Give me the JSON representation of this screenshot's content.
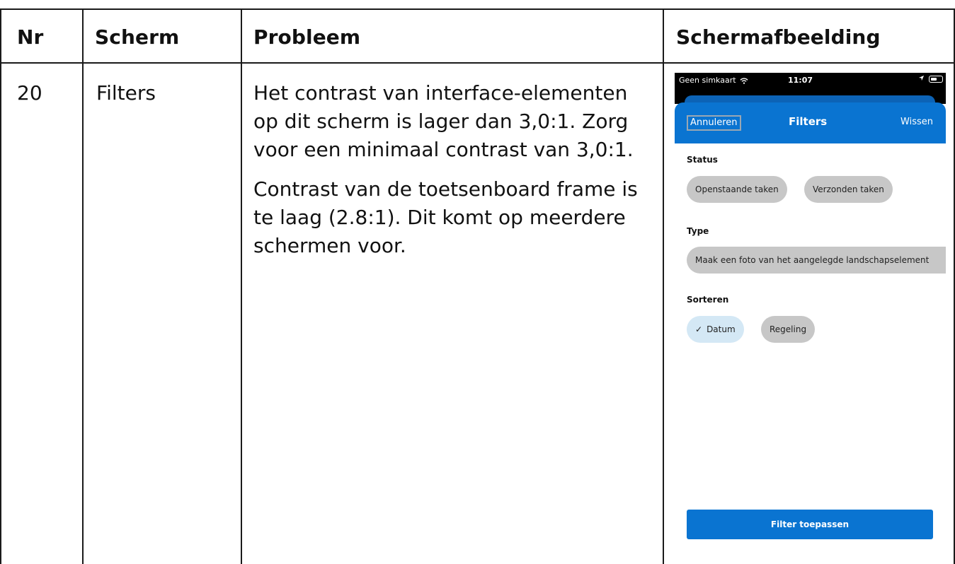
{
  "headers": {
    "nr": "Nr",
    "scherm": "Scherm",
    "probleem": "Probleem",
    "schermafbeelding": "Schermafbeelding"
  },
  "row": {
    "nr": "20",
    "scherm": "Filters",
    "probleem_paragraphs": [
      "Het contrast van interface-elementen op dit scherm is lager dan 3,0:1. Zorg voor een minimaal contrast van 3,0:1.",
      "Contrast van de toetsenboard frame is te laag (2.8:1). Dit komt op meerdere schermen voor."
    ]
  },
  "screenshot": {
    "status_bar": {
      "carrier": "Geen simkaart",
      "time": "11:07"
    },
    "header": {
      "cancel_label": "Annuleren",
      "title": "Filters",
      "clear_label": "Wissen"
    },
    "sections": {
      "status_label": "Status",
      "status_chips": [
        "Openstaande taken",
        "Verzonden taken"
      ],
      "type_label": "Type",
      "type_chip": "Maak een foto van het aangelegde landschapselement",
      "sort_label": "Sorteren",
      "sort_chips": [
        "Datum",
        "Regeling"
      ]
    },
    "apply_label": "Filter toepassen",
    "colors": {
      "primary_blue": "#0a74d1",
      "chip_grey": "#c7c7c7",
      "chip_selected": "#d4e8f5"
    },
    "icons": [
      "wifi-icon",
      "location-arrow-icon",
      "battery-icon",
      "checkmark-icon"
    ]
  }
}
